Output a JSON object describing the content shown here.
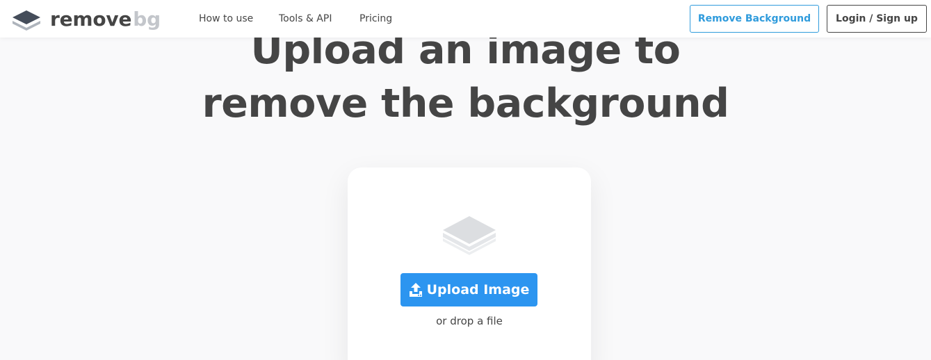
{
  "header": {
    "logo": {
      "text_main": "remove",
      "text_accent": "bg"
    },
    "nav": [
      {
        "label": "How to use"
      },
      {
        "label": "Tools & API"
      },
      {
        "label": "Pricing"
      }
    ],
    "remove_background_label": "Remove Background",
    "login_label": "Login / Sign up"
  },
  "hero": {
    "line1": "Upload an image to",
    "line2": "remove the background"
  },
  "upload": {
    "button_label": "Upload Image",
    "drop_text": "or drop a file"
  },
  "colors": {
    "text": "#454545",
    "accent_blue": "#2c95f0",
    "outline_blue": "#2f9bdc",
    "logo_gray": "#c3c6cb"
  },
  "icons": [
    "layers-logo-icon",
    "layers-placeholder-icon",
    "upload-icon"
  ]
}
